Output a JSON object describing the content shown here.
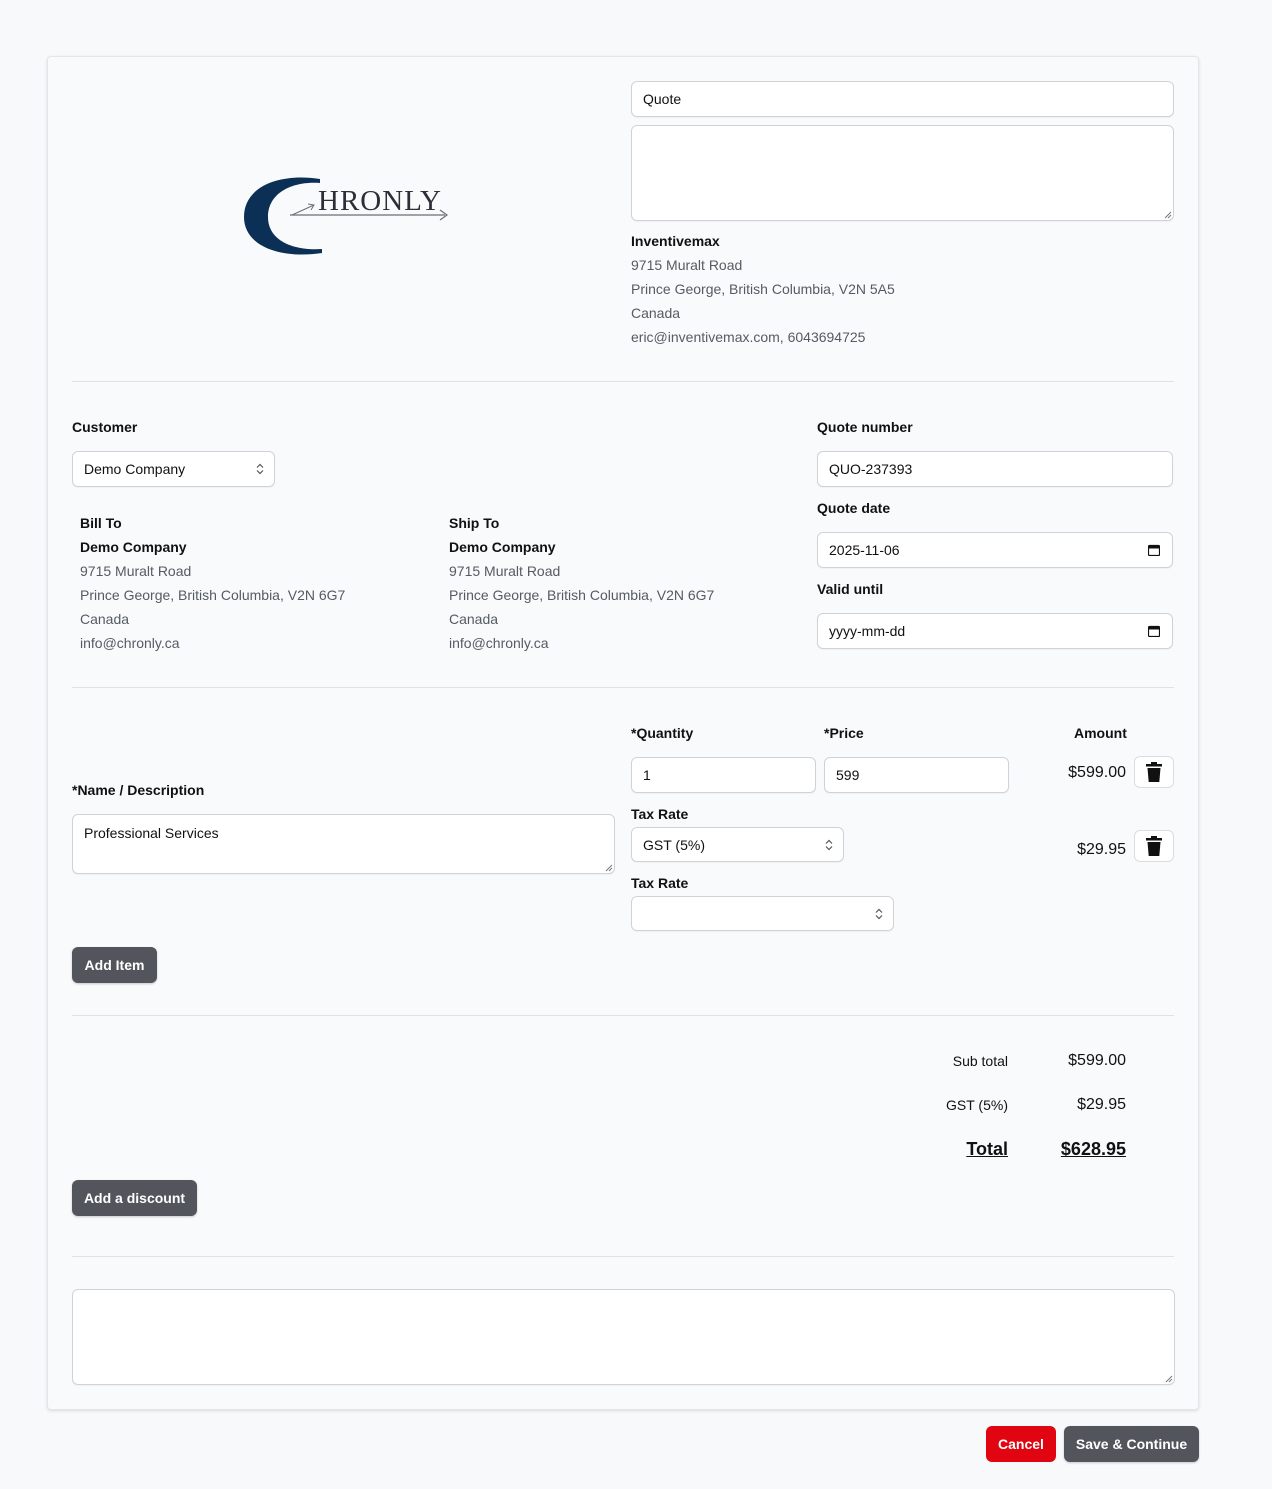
{
  "header": {
    "document_type": "Quote",
    "header_notes": "",
    "company": {
      "name": "Inventivemax",
      "address1": "9715 Muralt Road",
      "address2": "Prince George, British Columbia, V2N 5A5",
      "country": "Canada",
      "contact": "eric@inventivemax.com, 6043694725"
    },
    "logo_text": "HRONLY"
  },
  "customer": {
    "label": "Customer",
    "selected": "Demo Company",
    "bill_to": {
      "title": "Bill To",
      "name": "Demo Company",
      "address1": "9715 Muralt Road",
      "address2": "Prince George, British Columbia, V2N 6G7",
      "country": "Canada",
      "email": "info@chronly.ca"
    },
    "ship_to": {
      "title": "Ship To",
      "name": "Demo Company",
      "address1": "9715 Muralt Road",
      "address2": "Prince George, British Columbia, V2N 6G7",
      "country": "Canada",
      "email": "info@chronly.ca"
    }
  },
  "meta": {
    "quote_number_label": "Quote number",
    "quote_number": "QUO-237393",
    "quote_date_label": "Quote date",
    "quote_date": "2025-11-06",
    "valid_until_label": "Valid until",
    "valid_until": "yyyy-mm-dd"
  },
  "items": {
    "name_label": "*Name / Description",
    "quantity_label": "*Quantity",
    "price_label": "*Price",
    "amount_label": "Amount",
    "tax_rate_label": "Tax Rate",
    "rows": [
      {
        "description": "Professional Services",
        "quantity": "1",
        "price": "599",
        "amount": "$599.00",
        "tax_rate": "GST (5%)",
        "tax_amount": "$29.95",
        "tax_rate_2": ""
      }
    ],
    "add_item_label": "Add Item"
  },
  "totals": {
    "subtotal_label": "Sub total",
    "subtotal": "$599.00",
    "tax_label": "GST (5%)",
    "tax": "$29.95",
    "total_label": "Total",
    "total": "$628.95",
    "add_discount_label": "Add a discount"
  },
  "footer": {
    "notes": "",
    "cancel_label": "Cancel",
    "save_label": "Save & Continue"
  },
  "colors": {
    "logo_navy": "#0b2f55",
    "cancel_red": "#e00510",
    "dark_button": "#52555c"
  }
}
